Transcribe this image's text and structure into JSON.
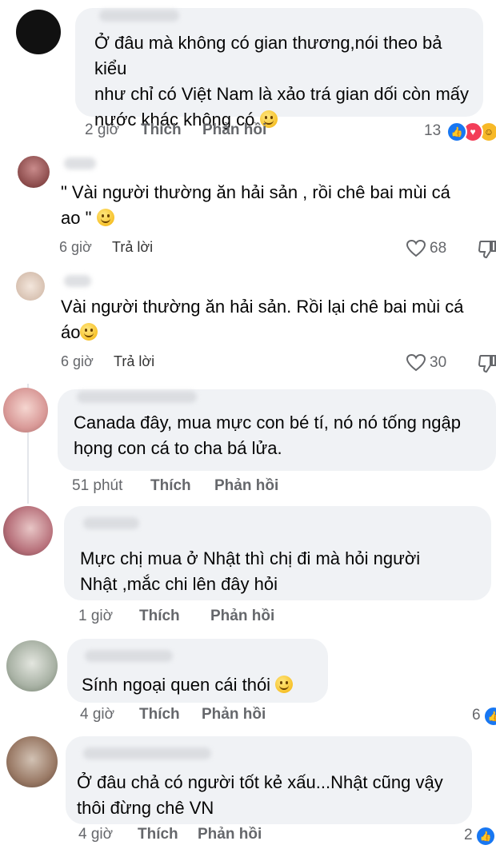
{
  "comments": [
    {
      "text": "Ở đâu mà không có gian thương,nói theo bả kiểu\nnhư chỉ có Việt Nam là xảo trá gian dối còn mấy\nnước khác không có",
      "time": "2 giờ",
      "like": "Thích",
      "reply": "Phản hồi",
      "count": "13",
      "reactions": [
        "like",
        "love",
        "haha"
      ]
    },
    {
      "text": "\" Vài người thường ăn hải sản , rồi chê bai mùi cá\nao \"",
      "time": "6 giờ",
      "reply": "Trả lời",
      "count": "68"
    },
    {
      "text": "Vài người thường ăn hải sản. Rồi lại chê bai mùi cá\náo",
      "time": "6 giờ",
      "reply": "Trả lời",
      "count": "30"
    },
    {
      "text": "Canada đây, mua mực con bé tí, nó nó tống ngập\nhọng con cá to cha bá lửa.",
      "time": "51 phút",
      "like": "Thích",
      "reply": "Phản hồi"
    },
    {
      "text": "Mực chị mua ở Nhật thì chị đi mà hỏi người\nNhật ,mắc chi lên đây hỏi",
      "time": "1 giờ",
      "like": "Thích",
      "reply": "Phản hồi"
    },
    {
      "text": "Sính ngoại quen cái thói",
      "time": "4 giờ",
      "like": "Thích",
      "reply": "Phản hồi",
      "count": "6"
    },
    {
      "text": "Ở đâu chả có người tốt kẻ xấu...Nhật cũng vậy\nthôi đừng chê VN",
      "time": "4 giờ",
      "like": "Thích",
      "reply": "Phản hồi",
      "count": "2"
    }
  ],
  "colors": {
    "bubble": "#f0f2f5",
    "meta": "#65676b",
    "like": "#1877f2",
    "love": "#f33e58",
    "haha": "#f7b928"
  }
}
